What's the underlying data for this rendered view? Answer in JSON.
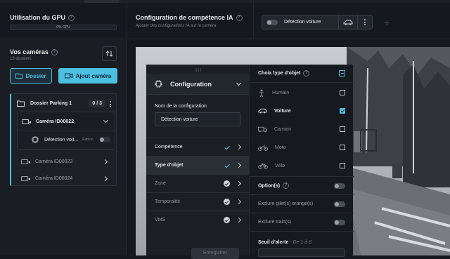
{
  "gpu": {
    "title": "Utilisation du GPU",
    "bar_text": "0% GPU",
    "usage": 0
  },
  "competence": {
    "title": "Configuration de compétence IA",
    "subtitle": "Ajouter des configurations IA sur la caméra"
  },
  "chip": {
    "label": "Détection voiture"
  },
  "sidebar": {
    "title": "Vos caméras",
    "count": "13 dossiers",
    "folder_button": "Dossier",
    "add_camera_button": "Ajout caméra",
    "folder": {
      "name": "Dossier Parking 1",
      "count": "0 / 3"
    },
    "cameras": [
      {
        "name": "Caméra ID00022"
      },
      {
        "name": "Caméra ID00023"
      },
      {
        "name": "Caméra ID00024"
      }
    ],
    "detection": {
      "name": "Détection voit...",
      "badge": "Édition"
    }
  },
  "config": {
    "header": "Configuration",
    "name_label": "Nom de la configuration",
    "name_value": "Détection voiture",
    "rows": [
      {
        "label": "Compétence"
      },
      {
        "label": "Type d'objet"
      },
      {
        "label": "Zone"
      },
      {
        "label": "Temporalité"
      },
      {
        "label": "VMS"
      }
    ],
    "save_button": "Enregistrer"
  },
  "object_type": {
    "header": "Choix type d'objet",
    "items": [
      {
        "label": "Humain",
        "checked": false
      },
      {
        "label": "Voiture",
        "checked": true
      },
      {
        "label": "Camion",
        "checked": false
      },
      {
        "label": "Moto",
        "checked": false
      },
      {
        "label": "Vélo",
        "checked": false
      }
    ],
    "options_label": "Option(s)",
    "exclude_vest": "Exclure gilet(s) orange(s)",
    "exclude_train": "Exclure train(s)",
    "threshold_label": "Seuil d'alerte",
    "threshold_hint": "De 1 à 6"
  },
  "colors": {
    "accent": "#4dbfe0",
    "background": "#15181e"
  }
}
